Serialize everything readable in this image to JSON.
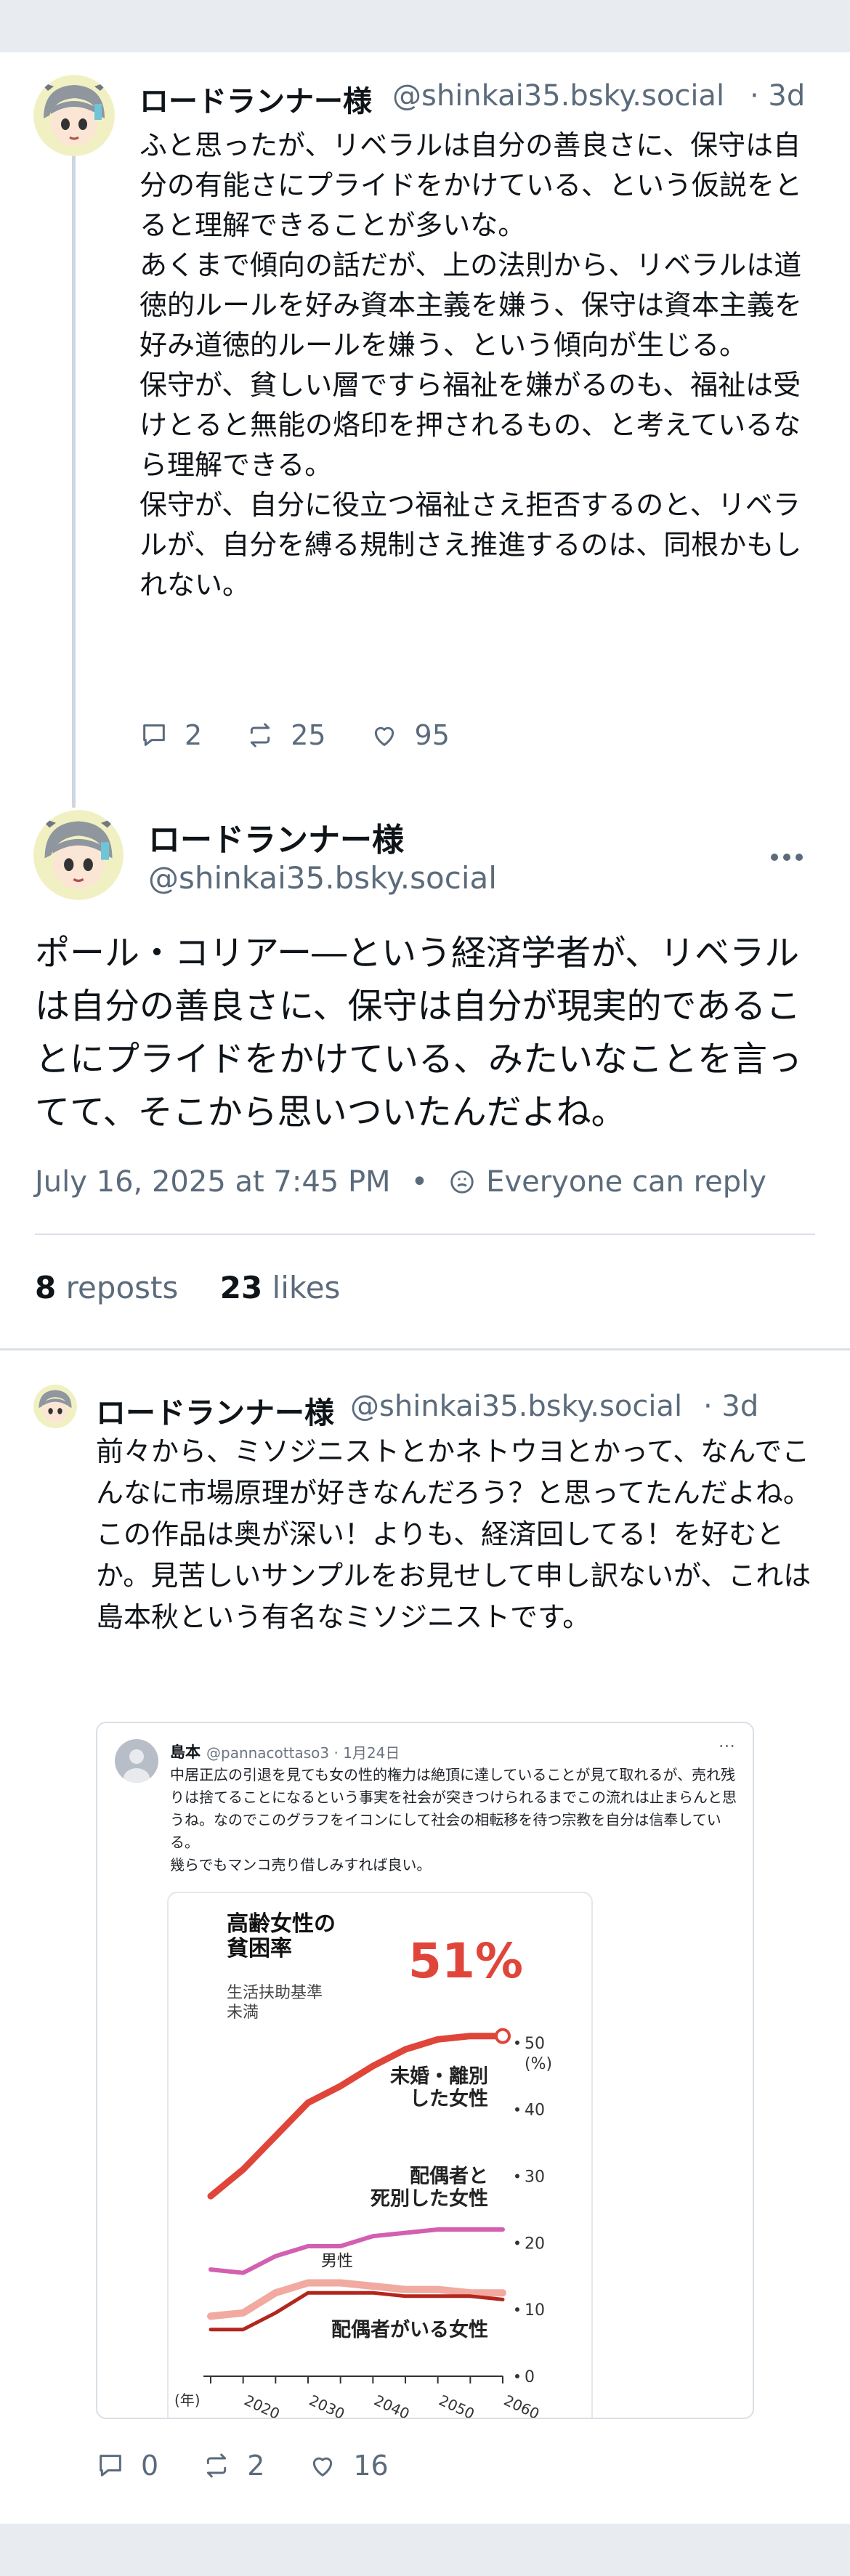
{
  "post1": {
    "author_name": "ロードランナー様",
    "handle": "@shinkai35.bsky.social",
    "time": "· 3d",
    "text": "ふと思ったが、リベラルは自分の善良さに、保守は自分の有能さにプライドをかけている、という仮説をとると理解できることが多いな。\nあくまで傾向の話だが、上の法則から、リベラルは道徳的ルールを好み資本主義を嫌う、保守は資本主義を好み道徳的ルールを嫌う、という傾向が生じる。\n保守が、貧しい層ですら福祉を嫌がるのも、福祉は受けとると無能の烙印を押されるもの、と考えているなら理解できる。\n保守が、自分に役立つ福祉さえ拒否するのと、リベラルが、自分を縛る規制さえ推進するのは、同根かもしれない。",
    "replies": "2",
    "reposts": "25",
    "likes": "95"
  },
  "main_post": {
    "author_name": "ロードランナー様",
    "handle": "@shinkai35.bsky.social",
    "text": "ポール・コリアー―という経済学者が、リベラルは自分の善良さに、保守は自分が現実的であることにプライドをかけている、みたいなことを言ってて、そこから思いついたんだよね。",
    "timestamp": "July 16, 2025 at 7:45 PM",
    "separator": "•",
    "reply_setting": "Everyone can reply",
    "reposts_count": "8",
    "reposts_label": "reposts",
    "likes_count": "23",
    "likes_label": "likes"
  },
  "reply": {
    "author_name": "ロードランナー様",
    "handle": "@shinkai35.bsky.social",
    "time": "· 3d",
    "text": "前々から、ミソジニストとかネトウヨとかって、なんでこんなに市場原理が好きなんだろう？と思ってたんだよね。この作品は奥が深い！よりも、経済回してる！を好むとか。見苦しいサンプルをお見せして申し訳ないが、これは島本秋という有名なミソジニストです。",
    "replies": "0",
    "reposts": "2",
    "likes": "16",
    "embed": {
      "name": "島本",
      "handle": "@pannacottaso3 · 1月24日",
      "text": "中居正広の引退を見ても女の性的権力は絶頂に達していることが見て取れるが、売れ残りは捨てることになるという事実を社会が突きつけられるまでこの流れは止まらんと思うね。なのでこのグラフをイコンにして社会の相転移を待つ宗教を自分は信奉している。\n幾らでもマンコ売り借しみすれば良い。"
    }
  },
  "chart_data": {
    "type": "line",
    "title": "高齢女性の\n貧困率",
    "subtitle": "生活扶助基準\n未満",
    "highlight": "51%",
    "y_unit": "(%)",
    "ylim": [
      0,
      55
    ],
    "yticks": [
      0,
      10,
      20,
      30,
      40,
      50
    ],
    "x_label": "(年)",
    "x": [
      2015,
      2020,
      2025,
      2030,
      2035,
      2040,
      2045,
      2050,
      2055,
      2060
    ],
    "series": [
      {
        "name": "未婚・離別\nした女性",
        "color": "#e0453a",
        "values": [
          27,
          31,
          36,
          41,
          43.5,
          46.5,
          49,
          50.5,
          51,
          51
        ]
      },
      {
        "name": "配偶者と\n死別した女性",
        "color": "#d35fb0",
        "values": [
          16,
          15.5,
          18,
          19.5,
          19.5,
          21,
          21.5,
          22,
          22,
          22
        ]
      },
      {
        "name": "男性",
        "color": "#f1a9a0",
        "values": [
          9,
          9.5,
          12.5,
          14,
          14,
          13.5,
          13,
          13,
          12.5,
          12.5
        ]
      },
      {
        "name": "配偶者がいる女性",
        "color": "#b3261e",
        "values": [
          7,
          7,
          9.5,
          12.5,
          12.5,
          12.5,
          12,
          12,
          12,
          11.5
        ]
      }
    ]
  },
  "colors": {
    "text": "#0f1419",
    "muted": "#5b6b7c",
    "divider": "#d9e0e7",
    "band": "#e8ecf1"
  }
}
